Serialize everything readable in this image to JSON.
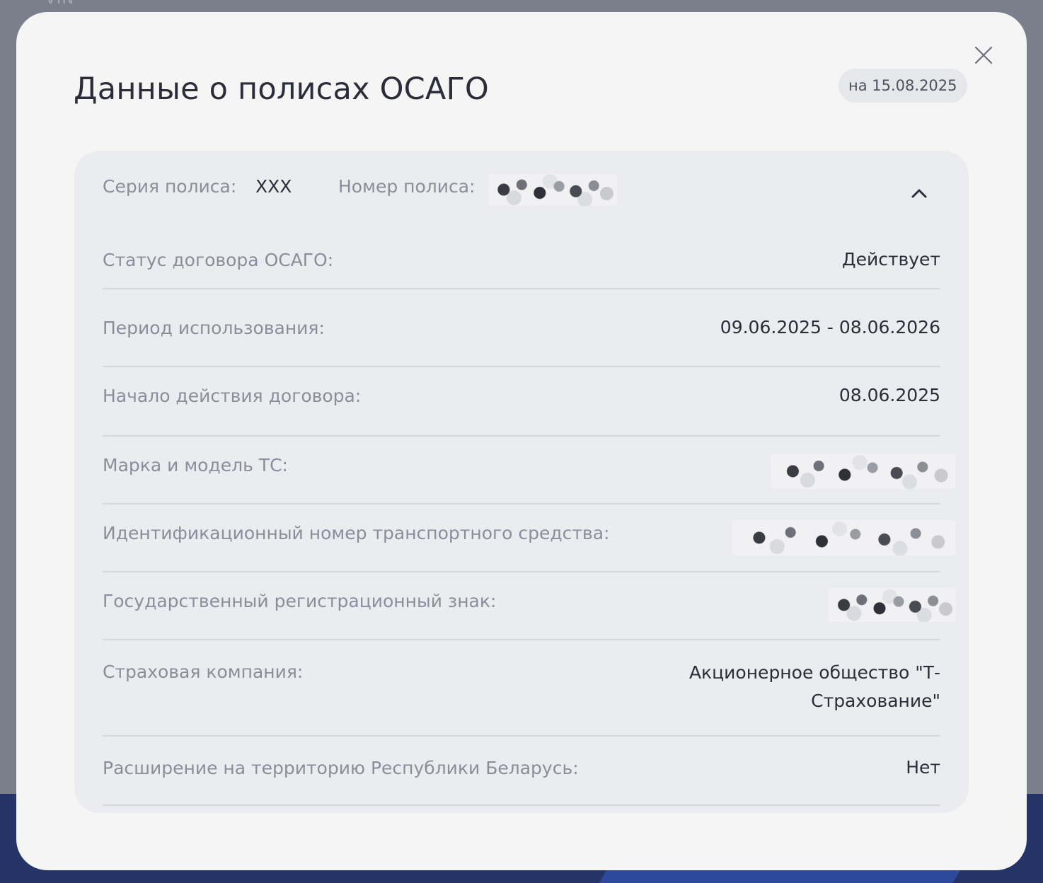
{
  "background": {
    "peek_text": "VIN"
  },
  "modal": {
    "title": "Данные о полисах ОСАГО",
    "date_badge": "на 15.08.2025",
    "close_icon": "close-icon"
  },
  "policy": {
    "series_label": "Серия полиса:",
    "series_value": "XXX",
    "number_label": "Номер полиса:",
    "number_value_hidden": true,
    "collapse_icon": "chevron-up-icon",
    "rows": [
      {
        "label": "Статус договора ОСАГО:",
        "value": "Действует"
      },
      {
        "label": "Период использования:",
        "value": "09.06.2025 - 08.06.2026"
      },
      {
        "label": "Начало действия договора:",
        "value": "08.06.2025"
      },
      {
        "label": "Марка и модель ТС:",
        "value": ""
      },
      {
        "label": "Идентификационный номер транспортного средства:",
        "value": ""
      },
      {
        "label": "Государственный регистрационный знак:",
        "value": ""
      },
      {
        "label": "Страховая компания:",
        "value": "Акционерное общество \"Т-Страхование\""
      },
      {
        "label": "Расширение на территорию Республики Беларусь:",
        "value": "Нет"
      }
    ]
  },
  "colors": {
    "overlay": "#7a7f8c",
    "modal_bg": "#f5f5f5",
    "card_bg": "#ebecf0",
    "label": "#8a8e9a",
    "value": "#2b2e3a"
  }
}
